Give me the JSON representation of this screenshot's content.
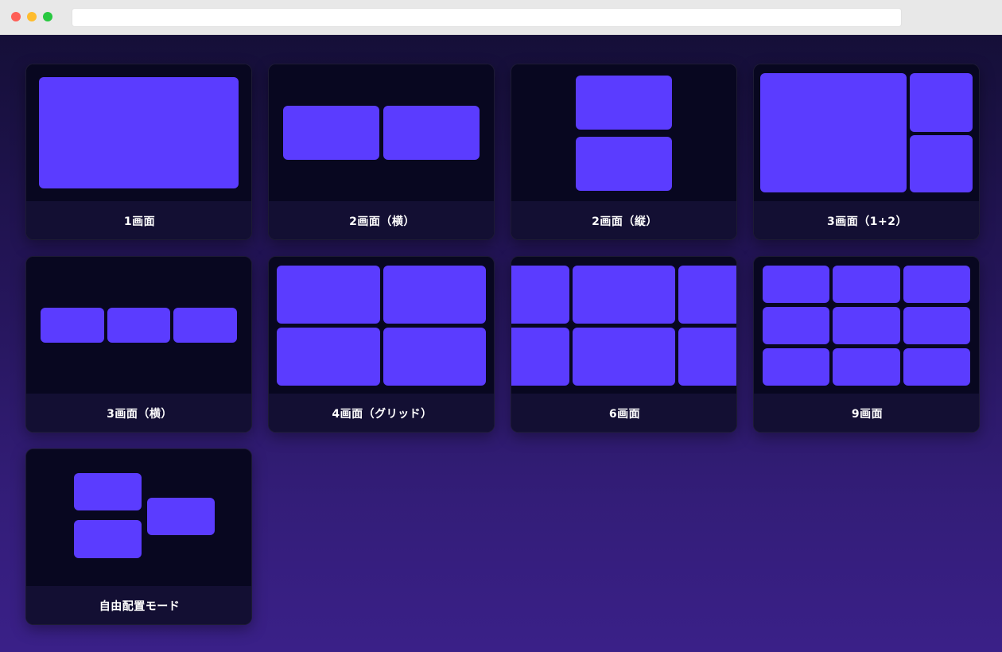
{
  "browser": {
    "url": ""
  },
  "layouts": [
    {
      "id": "single",
      "label": "1画面",
      "icon": "single-pane-layout-icon"
    },
    {
      "id": "dual-horizontal",
      "label": "2画面（横）",
      "icon": "two-pane-horizontal-icon"
    },
    {
      "id": "dual-vertical",
      "label": "2画面（縦）",
      "icon": "two-pane-vertical-icon"
    },
    {
      "id": "triple-1plus2",
      "label": "3画面（1+2）",
      "icon": "three-pane-one-plus-two-icon"
    },
    {
      "id": "triple-horizontal",
      "label": "3画面（横）",
      "icon": "three-pane-horizontal-icon"
    },
    {
      "id": "quad-grid",
      "label": "4画面（グリッド）",
      "icon": "four-pane-grid-icon"
    },
    {
      "id": "six",
      "label": "6画面",
      "icon": "six-pane-grid-icon"
    },
    {
      "id": "nine",
      "label": "9画面",
      "icon": "nine-pane-grid-icon"
    },
    {
      "id": "free",
      "label": "自由配置モード",
      "icon": "free-layout-icon"
    }
  ],
  "colors": {
    "pane": "#5b3cff",
    "card_preview_bg": "#080720",
    "card_label_bg": "#130f33",
    "background_top": "#150f38",
    "background_bottom": "#3a2088"
  }
}
